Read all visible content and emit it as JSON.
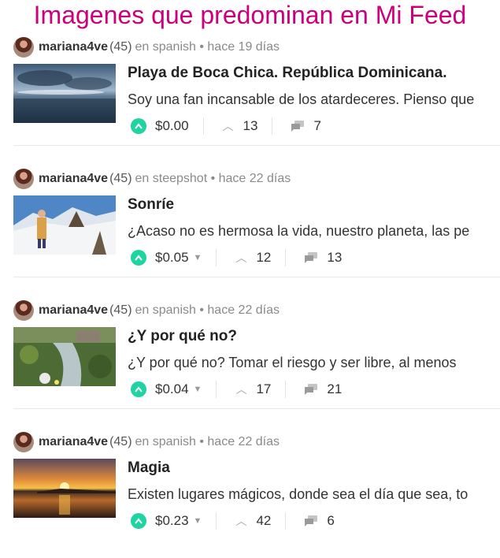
{
  "page": {
    "title": "Imagenes que predominan en Mi Feed"
  },
  "colors": {
    "title": "#cc007a",
    "upvote": "#1fd3a2",
    "meta": "#8a8a8a"
  },
  "posts": [
    {
      "author": "mariana4ve",
      "reputation": "(45)",
      "meta": "en spanish • hace 19 días",
      "title": "Playa de Boca Chica. República Dominicana.",
      "body": "Soy una fan incansable de los atardeceres. Pienso que",
      "payout": "$0.00",
      "votes": "13",
      "comments": "7",
      "has_caret": false,
      "thumb": "seascape-clouds"
    },
    {
      "author": "mariana4ve",
      "reputation": "(45)",
      "meta": "en steepshot • hace 22 días",
      "title": "Sonríe",
      "body": "¿Acaso no es hermosa la vida, nuestro planeta, las pe",
      "payout": "$0.05",
      "votes": "12",
      "comments": "13",
      "has_caret": true,
      "thumb": "snow-mountain-person"
    },
    {
      "author": "mariana4ve",
      "reputation": "(45)",
      "meta": "en spanish • hace 22 días",
      "title": "¿Y por qué no?",
      "body": "¿Y por qué no? Tomar el riesgo y ser libre, al menos",
      "payout": "$0.04",
      "votes": "17",
      "comments": "21",
      "has_caret": true,
      "thumb": "garden-stream"
    },
    {
      "author": "mariana4ve",
      "reputation": "(45)",
      "meta": "en spanish • hace 22 días",
      "title": "Magia",
      "body": "Existen lugares mágicos, donde sea el día que sea, to",
      "payout": "$0.23",
      "votes": "42",
      "comments": "6",
      "has_caret": true,
      "thumb": "sunset-lake"
    }
  ]
}
